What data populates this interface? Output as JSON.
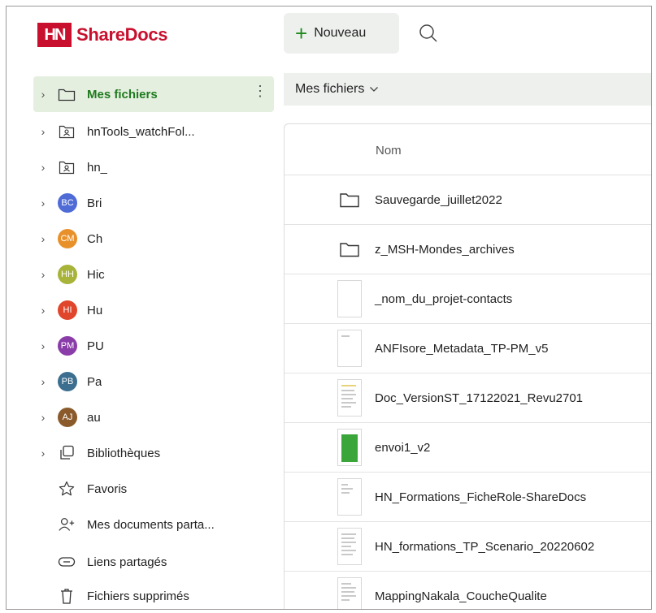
{
  "app": {
    "logo_mark": "HN",
    "name": "ShareDocs",
    "brand_color": "#c8102e",
    "accent_color": "#1b8a1b"
  },
  "toolbar": {
    "new_label": "Nouveau",
    "search_icon": "search-icon"
  },
  "breadcrumb": {
    "current": "Mes fichiers",
    "chevron": "⌵"
  },
  "sidebar": {
    "items": [
      {
        "label": "Mes fichiers",
        "icon": "folder-icon",
        "selected": true
      },
      {
        "label": "hnTools_watchFol...",
        "icon": "shared-folder-icon"
      },
      {
        "label": "hn_",
        "icon": "shared-folder-icon"
      },
      {
        "label": "Bri",
        "avatar": "BC",
        "color": "#4f6bd6"
      },
      {
        "label": "Ch",
        "avatar": "CM",
        "color": "#e8912b"
      },
      {
        "label": "Hic",
        "avatar": "HH",
        "color": "#a8b33a"
      },
      {
        "label": "Hu",
        "avatar": "HI",
        "color": "#e0462c"
      },
      {
        "label": "PU",
        "avatar": "PM",
        "color": "#8a3ca8"
      },
      {
        "label": "Pa",
        "avatar": "PB",
        "color": "#3b6e8f"
      },
      {
        "label": "au",
        "avatar": "AJ",
        "color": "#8a5a2b"
      },
      {
        "label": "Bibliothèques",
        "icon": "libraries-icon"
      },
      {
        "label": "Favoris",
        "icon": "star-icon"
      },
      {
        "label": "Mes documents parta...",
        "icon": "share-user-icon"
      },
      {
        "label": "Liens partagés",
        "icon": "link-icon"
      },
      {
        "label": "Fichiers supprimés",
        "icon": "trash-icon"
      }
    ]
  },
  "files": {
    "column_name": "Nom",
    "rows": [
      {
        "name": "Sauvegarde_juillet2022",
        "type": "folder"
      },
      {
        "name": "z_MSH-Mondes_archives",
        "type": "folder"
      },
      {
        "name": "_nom_du_projet-contacts",
        "type": "blank"
      },
      {
        "name": "ANFIsore_Metadata_TP-PM_v5",
        "type": "doc"
      },
      {
        "name": "Doc_VersionST_17122021_Revu2701",
        "type": "doc"
      },
      {
        "name": "envoi1_v2",
        "type": "sheet"
      },
      {
        "name": "HN_Formations_FicheRole-ShareDocs",
        "type": "doc"
      },
      {
        "name": "HN_formations_TP_Scenario_20220602",
        "type": "doc"
      },
      {
        "name": "MappingNakala_CoucheQualite",
        "type": "doc"
      }
    ]
  }
}
